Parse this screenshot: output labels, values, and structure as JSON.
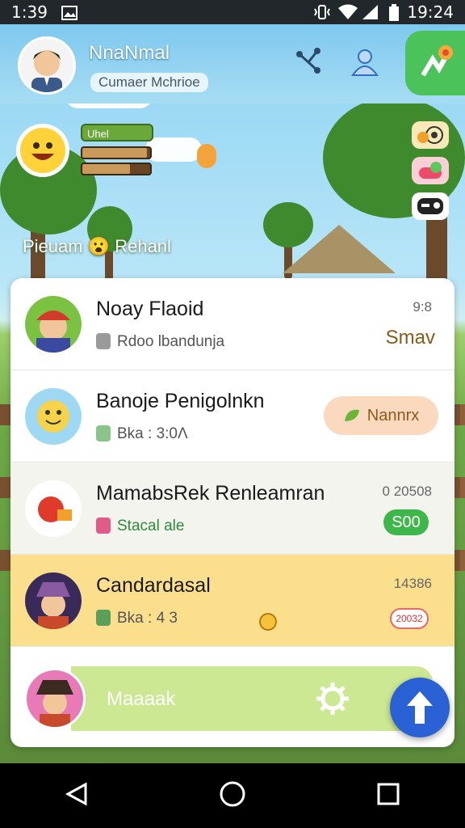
{
  "status_bar": {
    "time": "1:39",
    "clock": "19:24"
  },
  "header": {
    "user_name": "NnaNmal",
    "user_subtitle": "Cumaer Mchrioe"
  },
  "game": {
    "hud_label": "Uhel",
    "scene_title": "Pieuam 😮 Rehanl",
    "hud_bars": [
      0.95,
      0.7
    ]
  },
  "list": [
    {
      "title": "Noay Flaoid",
      "subtitle": "Rdoo lbandunja",
      "meta": "9:8",
      "action": "Smav"
    },
    {
      "title": "Banoje Penigolnkn",
      "subtitle": "Bka : 3:0Λ",
      "action": "Nannrx"
    },
    {
      "title": "MamabsRek Renleamran",
      "subtitle": "Stacal ale",
      "meta": "0 20508",
      "action": "S00"
    },
    {
      "title": "Candardasal",
      "subtitle": "Bka : 4 3",
      "meta": "14386",
      "action": "20032"
    },
    {
      "title": "Maaaak"
    }
  ],
  "colors": {
    "accent_blue": "#2a62d6",
    "green": "#4cc35a",
    "highlight_row": "#fbdf8c",
    "action_text": "#8a5a1a"
  },
  "icons": [
    "signal-icon",
    "wifi-icon",
    "battery-icon",
    "share-icon",
    "profile-icon",
    "flower-icon",
    "gear-icon",
    "arrow-up-icon",
    "back-icon",
    "home-icon",
    "recents-icon"
  ]
}
